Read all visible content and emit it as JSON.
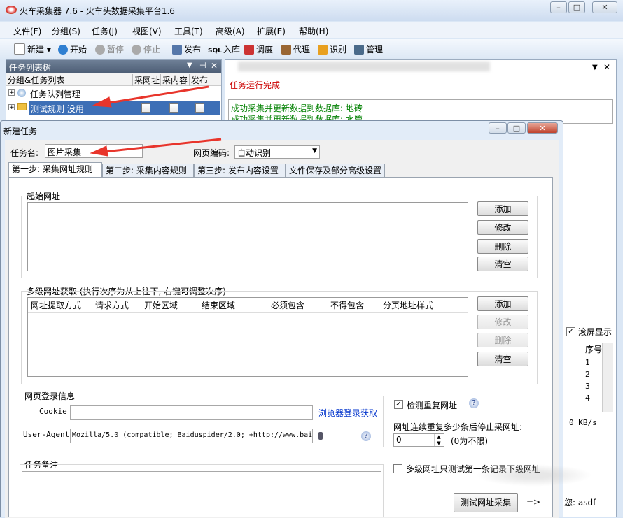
{
  "app": {
    "title": "火车采集器 7.6 - 火车头数据采集平台1.6",
    "menu": [
      "文件(F)",
      "分组(S)",
      "任务(J)",
      "视图(V)",
      "工具(T)",
      "高级(A)",
      "扩展(E)",
      "帮助(H)"
    ],
    "toolbar": {
      "new": "新建",
      "start": "开始",
      "pause": "暂停",
      "stop": "停止",
      "publish": "发布",
      "db_icon": "SQL",
      "db": "入库",
      "schedule": "调度",
      "proxy": "代理",
      "recognize": "识别",
      "manage": "管理"
    }
  },
  "task_tree": {
    "title": "任务列表树",
    "columns": [
      "分组&任务列表",
      "采网址",
      "采内容",
      "发布"
    ],
    "rows": [
      {
        "label": "任务队列管理",
        "checkboxes": false
      },
      {
        "label": "测试规则  没用",
        "checkboxes": true
      }
    ]
  },
  "right_panel": {
    "status_line": "任务运行完成",
    "log": [
      "成功采集并更新数据到数据库: 地砖",
      "成功采集并更新数据到数据库: 水管"
    ],
    "scroll_display": "滚屏显示",
    "seq_header": "序号",
    "seq": [
      "1",
      "2",
      "3",
      "4"
    ],
    "speed": "0 KB/s",
    "user": "您: asdf"
  },
  "dialog": {
    "title": "新建任务",
    "task_name_label": "任务名:",
    "task_name_value": "图片采集",
    "encoding_label": "网页编码:",
    "encoding_value": "自动识别",
    "tabs": [
      "第一步: 采集网址规则",
      "第二步: 采集内容规则",
      "第三步: 发布内容设置",
      "文件保存及部分高级设置"
    ],
    "start_url": {
      "legend": "起始网址",
      "buttons": [
        "添加",
        "修改",
        "删除",
        "清空"
      ]
    },
    "multi": {
      "legend": "多级网址获取 (执行次序为从上往下, 右键可调整次序)",
      "columns": [
        "网址提取方式",
        "请求方式",
        "开始区域",
        "结束区域",
        "必须包含",
        "不得包含",
        "分页地址样式"
      ],
      "buttons": [
        "添加",
        "修改",
        "删除",
        "清空"
      ]
    },
    "login": {
      "legend": "网页登录信息",
      "cookie_label": "Cookie",
      "cookie_value": "",
      "browser_link": "浏览器登录获取",
      "ua_label": "User-Agent",
      "ua_value": "Mozilla/5.0 (compatible; Baiduspider/2.0; +http://www.bai"
    },
    "options": {
      "check_dup": "检测重复网址",
      "check_dup_checked": true,
      "stop_label": "网址连续重复多少条后停止采网址:",
      "stop_value": "0",
      "stop_hint": "(0为不限)",
      "multi_test": "多级网址只测试第一条记录下级网址",
      "multi_test_checked": false
    },
    "notes_legend": "任务备注",
    "test_button": "测试网址采集",
    "arrow": "=>"
  },
  "colors": {
    "arrow": "#e8352b",
    "selected_row": "#3d6fb6",
    "link": "#0033cc",
    "log_green": "#008000",
    "status_red": "#cc0000"
  }
}
